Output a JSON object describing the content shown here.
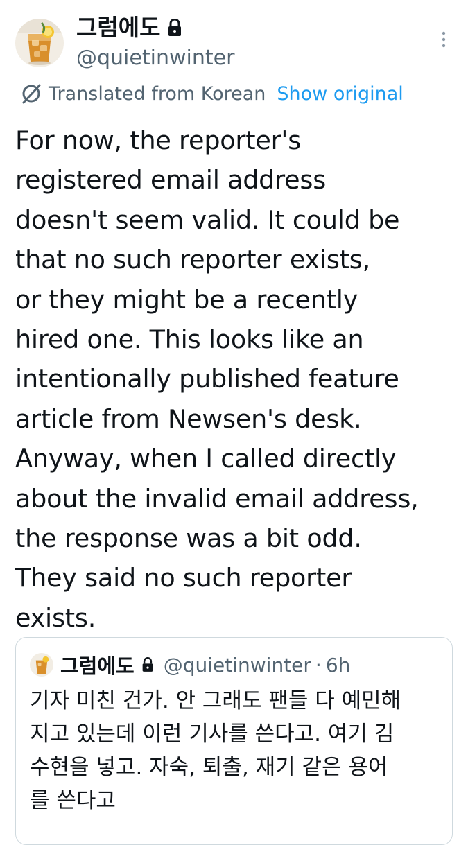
{
  "author": {
    "display_name": "그럼에도",
    "handle": "@quietinwinter",
    "avatar": "iced-drink-avatar",
    "protected_icon": "lock-icon"
  },
  "menu": {
    "icon": "more-vertical-icon"
  },
  "translation": {
    "icon": "translate-icon",
    "label": "Translated from Korean",
    "show_original_label": "Show original"
  },
  "tweet": {
    "text": "For now, the reporter's\nregistered email address\ndoesn't seem valid. It could be\nthat no such reporter exists,\nor they might be a recently\nhired one. This looks like an\nintentionally published feature\narticle from Newsen's desk.\nAnyway, when I called directly\nabout the invalid email address,\nthe response was a bit odd.\nThey said no such reporter\nexists."
  },
  "quote": {
    "display_name": "그럼에도",
    "handle": "@quietinwinter",
    "separator": "·",
    "time": "6h",
    "text": "기자 미친 건가. 안 그래도 팬들 다 예민해\n지고 있는데 이런 기사를 쓴다고. 여기 김\n수현을 넣고. 자숙, 퇴출, 재기 같은 용어\n를 쓴다고"
  },
  "colors": {
    "text": "#0f1419",
    "secondary": "#536471",
    "link": "#1d9bf0",
    "border": "#cfd9de"
  }
}
